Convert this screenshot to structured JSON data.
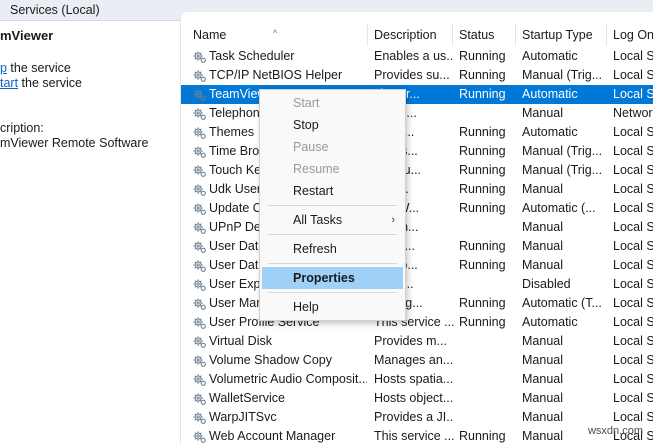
{
  "window": {
    "title": "Services (Local)"
  },
  "left_pane": {
    "service_name": "mViewer",
    "stop_link": "p",
    "stop_text": " the service",
    "restart_link": "tart",
    "restart_text": " the service",
    "description_label": "cription:",
    "description_value": "mViewer Remote Software"
  },
  "columns": {
    "name": "Name",
    "description": "Description",
    "status": "Status",
    "startup_type": "Startup Type",
    "log_on": "Log On"
  },
  "sort_indicator": "^",
  "services": [
    {
      "name": "Task Scheduler",
      "description": "Enables a us...",
      "status": "Running",
      "startup": "Automatic",
      "logon": "Local Sy"
    },
    {
      "name": "TCP/IP NetBIOS Helper",
      "description": "Provides su...",
      "status": "Running",
      "startup": "Manual (Trig...",
      "logon": "Local Se"
    },
    {
      "name": "TeamViewer",
      "description": "viewer...",
      "status": "Running",
      "startup": "Automatic",
      "logon": "Local Sy",
      "selected": true
    },
    {
      "name": "Telephony",
      "description": "es Tel...",
      "status": "",
      "startup": "Manual",
      "logon": "Networ"
    },
    {
      "name": "Themes",
      "description": "es us...",
      "status": "Running",
      "startup": "Automatic",
      "logon": "Local Sy"
    },
    {
      "name": "Time Broker",
      "description": "inates...",
      "status": "Running",
      "startup": "Manual (Trig...",
      "logon": "Local Se"
    },
    {
      "name": "Touch Keyboard",
      "description": "es Tou...",
      "status": "Running",
      "startup": "Manual (Trig...",
      "logon": "Local Sy"
    },
    {
      "name": "Udk User",
      "description": "omp...",
      "status": "Running",
      "startup": "Manual",
      "logon": "Local Sy"
    },
    {
      "name": "Update Orchestrator",
      "description": "ges W...",
      "status": "Running",
      "startup": "Automatic (...",
      "logon": "Local Sy"
    },
    {
      "name": "UPnP Device Host",
      "description": "s UPn...",
      "status": "",
      "startup": "Manual",
      "logon": "Local Se"
    },
    {
      "name": "User Data Access",
      "description": "es ap...",
      "status": "Running",
      "startup": "Manual",
      "logon": "Local Sy"
    },
    {
      "name": "User Data Storage",
      "description": "es sto...",
      "status": "Running",
      "startup": "Manual",
      "logon": "Local Sy"
    },
    {
      "name": "User Experience",
      "description": "rt for ...",
      "status": "",
      "startup": "Disabled",
      "logon": "Local Sy"
    },
    {
      "name": "User Manager",
      "description": "Manag...",
      "status": "Running",
      "startup": "Automatic (T...",
      "logon": "Local Sy"
    },
    {
      "name": "User Profile Service",
      "description": "This service ...",
      "status": "Running",
      "startup": "Automatic",
      "logon": "Local Sy"
    },
    {
      "name": "Virtual Disk",
      "description": "Provides m...",
      "status": "",
      "startup": "Manual",
      "logon": "Local Sy"
    },
    {
      "name": "Volume Shadow Copy",
      "description": "Manages an...",
      "status": "",
      "startup": "Manual",
      "logon": "Local Sy"
    },
    {
      "name": "Volumetric Audio Composit...",
      "description": "Hosts spatia...",
      "status": "",
      "startup": "Manual",
      "logon": "Local Se"
    },
    {
      "name": "WalletService",
      "description": "Hosts object...",
      "status": "",
      "startup": "Manual",
      "logon": "Local Sy"
    },
    {
      "name": "WarpJITSvc",
      "description": "Provides a JI...",
      "status": "",
      "startup": "Manual",
      "logon": "Local Se"
    },
    {
      "name": "Web Account Manager",
      "description": "This service ...",
      "status": "Running",
      "startup": "Manual",
      "logon": "Local Sy"
    }
  ],
  "context_menu": {
    "start": "Start",
    "stop": "Stop",
    "pause": "Pause",
    "resume": "Resume",
    "restart": "Restart",
    "all_tasks": "All Tasks",
    "all_tasks_arrow": "›",
    "refresh": "Refresh",
    "properties": "Properties",
    "help": "Help"
  },
  "watermark": "wsxdn.com"
}
